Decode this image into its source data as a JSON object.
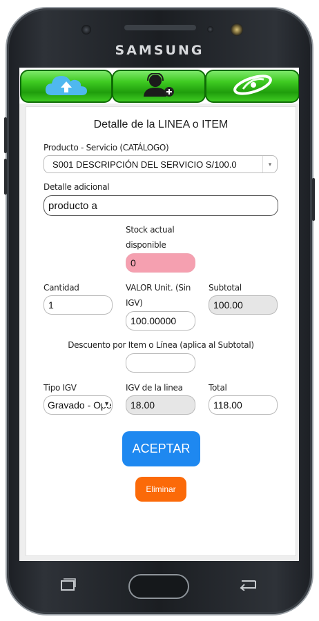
{
  "device": {
    "brand": "SAMSUNG"
  },
  "nav": {
    "items": [
      {
        "icon": "cloud-upload-icon"
      },
      {
        "icon": "support-agent-icon"
      },
      {
        "icon": "swirl-logo-icon"
      }
    ],
    "color": "#3fcb22"
  },
  "form": {
    "title": "Detalle de la LINEA o ITEM",
    "product_label": "Producto - Servicio (CATÁLOGO)",
    "product_value": "S001 DESCRIPCIÓN DEL SERVICIO S/100.0",
    "detail_label": "Detalle adicional",
    "detail_value": "producto a",
    "stock_label_1": "Stock actual",
    "stock_label_2": "disponible",
    "stock_value": "0",
    "qty_label": "Cantidad",
    "qty_value": "1",
    "unit_label_1": "VALOR Unit. (Sin",
    "unit_label_2": "IGV)",
    "unit_value": "100.00000",
    "subtotal_label": "Subtotal",
    "subtotal_value": "100.00",
    "discount_label": "Descuento por Item o Línea (aplica al Subtotal)",
    "discount_value": "",
    "tipo_label": "Tipo IGV",
    "tipo_value": "Gravado - Ope",
    "igv_label": "IGV de la linea",
    "igv_value": "18.00",
    "total_label": "Total",
    "total_value": "118.00"
  },
  "buttons": {
    "accept": "ACEPTAR",
    "delete": "Eliminar"
  },
  "colors": {
    "accept": "#1e88f0",
    "delete": "#fb6a09",
    "stock_bg": "#f5a0b0"
  }
}
